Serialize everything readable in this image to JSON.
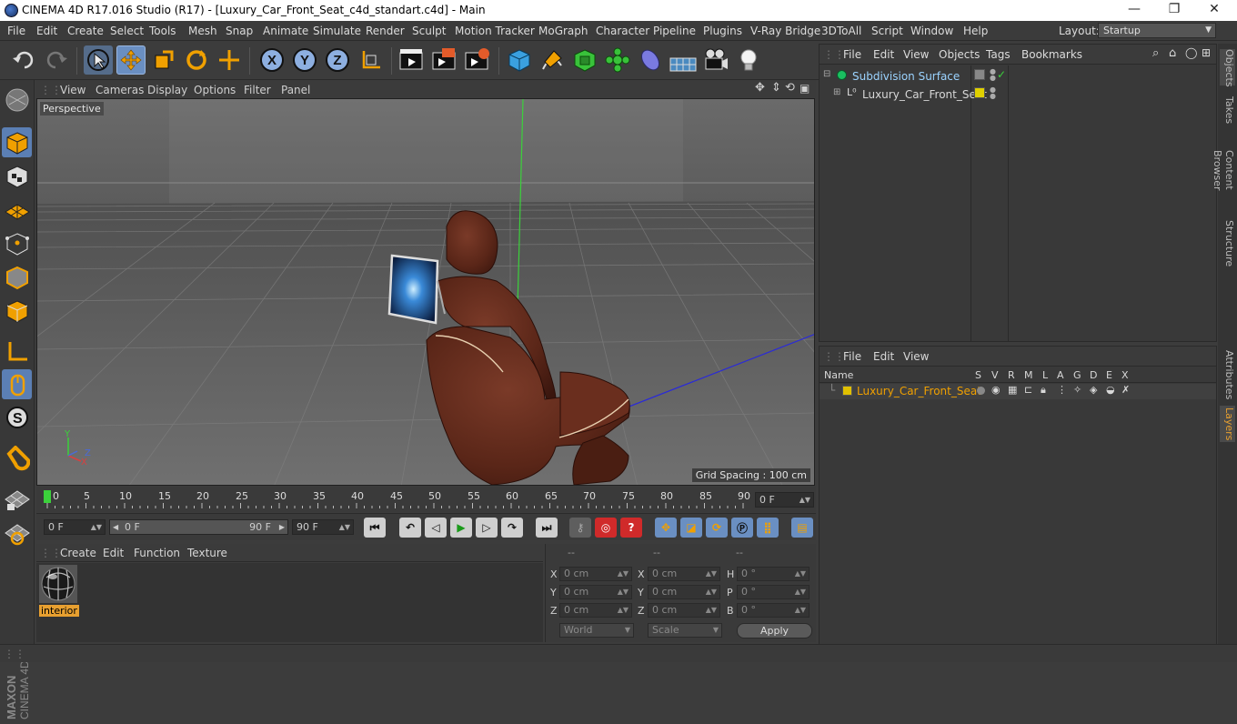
{
  "titlebar": {
    "title": "CINEMA 4D R17.016 Studio (R17) - [Luxury_Car_Front_Seat_c4d_standart.c4d] - Main",
    "minimize": "—",
    "restore": "❐",
    "close": "✕"
  },
  "menubar": {
    "items": [
      "File",
      "Edit",
      "Create",
      "Select",
      "Tools",
      "Mesh",
      "Snap",
      "Animate",
      "Simulate",
      "Render",
      "Sculpt",
      "Motion Tracker",
      "MoGraph",
      "Character",
      "Pipeline",
      "Plugins",
      "V-Ray Bridge",
      "3DToAll",
      "Script",
      "Window",
      "Help"
    ],
    "layout_label": "Layout:",
    "layout_value": "Startup"
  },
  "toolbar": {
    "axis_x": "X",
    "axis_y": "Y",
    "axis_z": "Z"
  },
  "viewport": {
    "menu": [
      "View",
      "Cameras",
      "Display",
      "Options",
      "Filter",
      "Panel"
    ],
    "camera_label": "Perspective",
    "grid_spacing": "Grid Spacing : 100 cm",
    "axis_y": "Y",
    "axis_z": "Z",
    "axis_x": "X"
  },
  "timeline": {
    "ticks": [
      "0",
      "5",
      "10",
      "15",
      "20",
      "25",
      "30",
      "35",
      "40",
      "45",
      "50",
      "55",
      "60",
      "65",
      "70",
      "75",
      "80",
      "85",
      "90"
    ],
    "current_frame": "0 F"
  },
  "transport": {
    "start_field": "0 F",
    "range_start": "0 F",
    "range_end": "90 F",
    "end_field": "90 F"
  },
  "material_manager": {
    "menu": [
      "Create",
      "Edit",
      "Function",
      "Texture"
    ],
    "materials": [
      {
        "name": "interior"
      }
    ]
  },
  "coordinates": {
    "headers": [
      "--",
      "--",
      "--"
    ],
    "rows": [
      {
        "l1": "X",
        "v1": "0 cm",
        "l2": "X",
        "v2": "0 cm",
        "l3": "H",
        "v3": "0 °"
      },
      {
        "l1": "Y",
        "v1": "0 cm",
        "l2": "Y",
        "v2": "0 cm",
        "l3": "P",
        "v3": "0 °"
      },
      {
        "l1": "Z",
        "v1": "0 cm",
        "l2": "Z",
        "v2": "0 cm",
        "l3": "B",
        "v3": "0 °"
      }
    ],
    "space_select": "World",
    "mode_select": "Scale",
    "apply_label": "Apply"
  },
  "object_manager": {
    "menu": [
      "File",
      "Edit",
      "View",
      "Objects",
      "Tags",
      "Bookmarks"
    ],
    "objects": [
      {
        "name": "Subdivision Surface",
        "color": "#9bd3ff"
      },
      {
        "name": "Luxury_Car_Front_Seat",
        "color": "#d8d8d8"
      }
    ]
  },
  "layer_manager": {
    "menu": [
      "File",
      "Edit",
      "View"
    ],
    "columns": {
      "name": "Name",
      "flags": [
        "S",
        "V",
        "R",
        "M",
        "L",
        "A",
        "G",
        "D",
        "E",
        "X"
      ]
    },
    "layers": [
      {
        "name": "Luxury_Car_Front_Seat",
        "color": "#e0c000"
      }
    ]
  },
  "right_tabs": [
    "Objects",
    "Takes",
    "Content Browser",
    "Structure",
    "Attributes",
    "Layers"
  ],
  "maxon": {
    "brand": "MAXON",
    "product": "CINEMA 4D"
  },
  "colors": {
    "accent": "#6a8fc2",
    "layer_yellow": "#e0c000",
    "active_tab": "#e8a030"
  }
}
